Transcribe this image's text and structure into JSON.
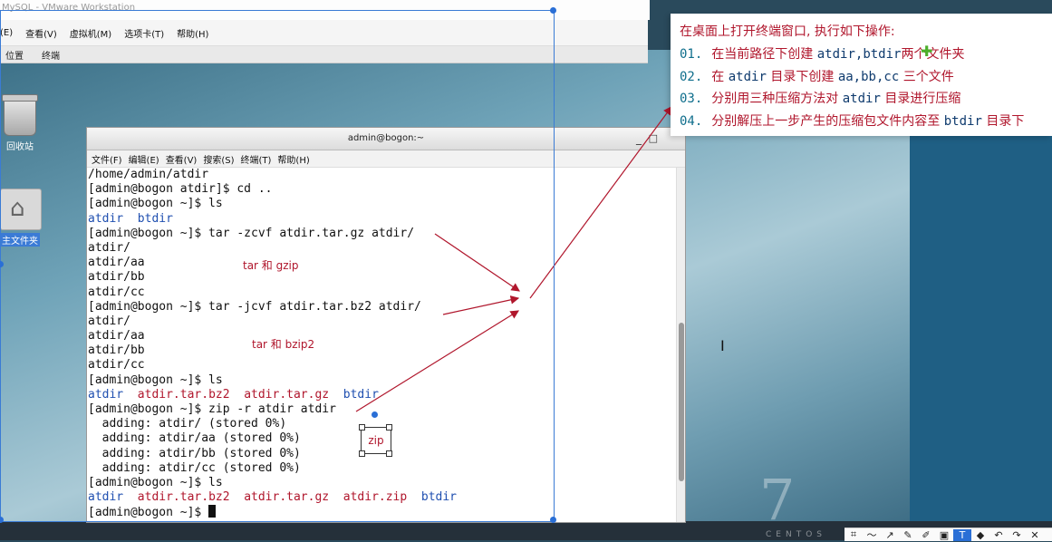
{
  "vm_window": {
    "title": "MySQL - VMware Workstation",
    "menu": [
      "(E)",
      "查看(V)",
      "虚拟机(M)",
      "选项卡(T)",
      "帮助(H)"
    ]
  },
  "guest_topbar": [
    "位置",
    "终端"
  ],
  "desktop_icons": [
    {
      "label": "回收站",
      "icon": "trash-icon"
    },
    {
      "label": "主文件夹",
      "icon": "home-folder-icon"
    }
  ],
  "terminal": {
    "title": "admin@bogon:~",
    "menu": [
      "文件(F)",
      "编辑(E)",
      "查看(V)",
      "搜索(S)",
      "终端(T)",
      "帮助(H)"
    ],
    "lines": [
      [
        {
          "t": "/home/admin/atdir",
          "c": ""
        }
      ],
      [
        {
          "t": "[admin@bogon atdir]$ cd ..",
          "c": ""
        }
      ],
      [
        {
          "t": "[admin@bogon ~]$ ls",
          "c": ""
        }
      ],
      [
        {
          "t": "atdir  btdir",
          "c": "blue"
        }
      ],
      [
        {
          "t": "[admin@bogon ~]$ tar -zcvf atdir.tar.gz atdir/",
          "c": ""
        }
      ],
      [
        {
          "t": "atdir/",
          "c": ""
        }
      ],
      [
        {
          "t": "atdir/aa",
          "c": ""
        }
      ],
      [
        {
          "t": "atdir/bb",
          "c": ""
        }
      ],
      [
        {
          "t": "atdir/cc",
          "c": ""
        }
      ],
      [
        {
          "t": "[admin@bogon ~]$ tar -jcvf atdir.tar.bz2 atdir/",
          "c": ""
        }
      ],
      [
        {
          "t": "atdir/",
          "c": ""
        }
      ],
      [
        {
          "t": "atdir/aa",
          "c": ""
        }
      ],
      [
        {
          "t": "atdir/bb",
          "c": ""
        }
      ],
      [
        {
          "t": "atdir/cc",
          "c": ""
        }
      ],
      [
        {
          "t": "[admin@bogon ~]$ ls",
          "c": ""
        }
      ],
      [
        {
          "t": "atdir  ",
          "c": "blue"
        },
        {
          "t": "atdir.tar.bz2  atdir.tar.gz  ",
          "c": "red"
        },
        {
          "t": "btdir",
          "c": "blue"
        }
      ],
      [
        {
          "t": "[admin@bogon ~]$ zip -r atdir atdir",
          "c": ""
        }
      ],
      [
        {
          "t": "  adding: atdir/ (stored 0%)",
          "c": ""
        }
      ],
      [
        {
          "t": "  adding: atdir/aa (stored 0%)",
          "c": ""
        }
      ],
      [
        {
          "t": "  adding: atdir/bb (stored 0%)",
          "c": ""
        }
      ],
      [
        {
          "t": "  adding: atdir/cc (stored 0%)",
          "c": ""
        }
      ],
      [
        {
          "t": "[admin@bogon ~]$ ls",
          "c": ""
        }
      ],
      [
        {
          "t": "atdir  ",
          "c": "blue"
        },
        {
          "t": "atdir.tar.bz2  atdir.tar.gz  atdir.zip  ",
          "c": "red"
        },
        {
          "t": "btdir",
          "c": "blue"
        }
      ],
      [
        {
          "t": "[admin@bogon ~]$ ",
          "c": ""
        }
      ]
    ]
  },
  "annotations": {
    "gzip": "tar 和 gzip",
    "bzip2": "tar 和 bzip2",
    "zip": "zip"
  },
  "instructions": {
    "title": "在桌面上打开终端窗口, 执行如下操作:",
    "items": [
      {
        "num": "01.",
        "parts": [
          {
            "t": "在当前路径下创建 ",
            "m": false
          },
          {
            "t": "atdir,btdir",
            "m": true
          },
          {
            "t": "两个文件夹",
            "m": false
          }
        ]
      },
      {
        "num": "02.",
        "parts": [
          {
            "t": "在 ",
            "m": false
          },
          {
            "t": "atdir",
            "m": true
          },
          {
            "t": " 目录下创建 ",
            "m": false
          },
          {
            "t": "aa,bb,cc",
            "m": true
          },
          {
            "t": " 三个文件",
            "m": false
          }
        ]
      },
      {
        "num": "03.",
        "parts": [
          {
            "t": "分别用三种压缩方法对 ",
            "m": false
          },
          {
            "t": "atdir",
            "m": true
          },
          {
            "t": " 目录进行压缩",
            "m": false
          }
        ]
      },
      {
        "num": "04.",
        "parts": [
          {
            "t": "分别解压上一步产生的压缩包文件内容至 ",
            "m": false
          },
          {
            "t": "btdir",
            "m": true
          },
          {
            "t": " 目录下",
            "m": false
          }
        ]
      }
    ]
  },
  "centos": {
    "num": "7",
    "word": "CENTOS"
  },
  "colors": {
    "accent_red": "#b0162c",
    "selection_blue": "#2a6fd6",
    "terminal_blue": "#1f4fb0"
  }
}
